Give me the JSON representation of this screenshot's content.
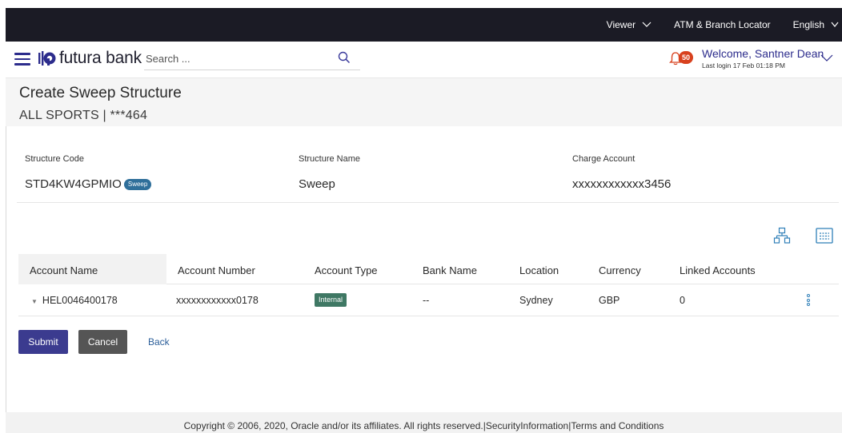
{
  "topbar": {
    "viewer": "Viewer",
    "locator": "ATM & Branch Locator",
    "language": "English"
  },
  "header": {
    "logo_text": "futura bank",
    "search_placeholder": "Search ...",
    "notification_count": "50",
    "welcome": "Welcome, Santner Dean",
    "last_login": "Last login 17 Feb 01:18 PM"
  },
  "page": {
    "title": "Create Sweep Structure",
    "subtitle": "ALL SPORTS | ***464"
  },
  "structure": {
    "code_label": "Structure Code",
    "code_value": "STD4KW4GPMIO",
    "code_badge": "Sweep",
    "name_label": "Structure Name",
    "name_value": "Sweep",
    "charge_label": "Charge Account",
    "charge_value": "xxxxxxxxxxxx3456"
  },
  "table": {
    "columns": [
      "Account Name",
      "Account Number",
      "Account Type",
      "Bank Name",
      "Location",
      "Currency",
      "Linked Accounts"
    ],
    "rows": [
      {
        "account_name": "HEL0046400178",
        "account_number": "xxxxxxxxxxxx0178",
        "account_type": "Internal",
        "bank_name": "--",
        "location": "Sydney",
        "currency": "GBP",
        "linked_accounts": "0"
      }
    ]
  },
  "actions": {
    "submit": "Submit",
    "cancel": "Cancel",
    "back": "Back"
  },
  "footer": {
    "text": "Copyright © 2006, 2020, Oracle and/or its affiliates. All rights reserved.|SecurityInformation|Terms and Conditions"
  },
  "colors": {
    "topbar": "#1b1b25",
    "brand": "#2c2c8c",
    "badge": "#d8411e",
    "sweep_pill": "#2f6f9a",
    "internal_pill": "#3f7864",
    "submit": "#3b3b8f",
    "cancel": "#555555"
  },
  "icons": [
    "chevron-down-icon",
    "hamburger-menu-icon",
    "futura-logo-icon",
    "search-icon",
    "bell-icon",
    "tree-view-icon",
    "grid-view-icon",
    "kebab-menu-icon"
  ]
}
